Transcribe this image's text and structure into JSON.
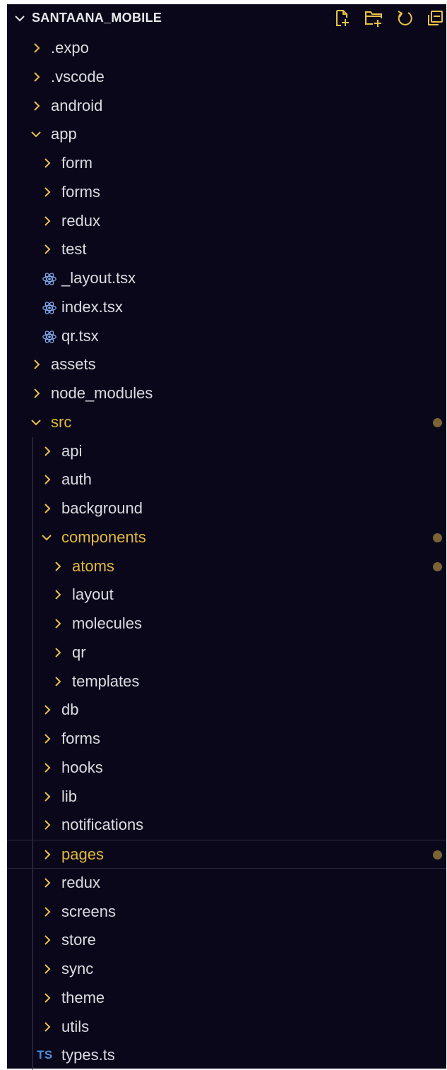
{
  "explorer": {
    "title": "SANTAANA_MOBILE",
    "actions": [
      "new-file-icon",
      "new-folder-icon",
      "refresh-icon",
      "collapse-all-icon"
    ]
  },
  "colors": {
    "background": "#090719",
    "modified_text": "#e2b93b",
    "arrow": "#e8c14a",
    "modified_dot": "#7a6435",
    "react_icon": "#7fa7e8",
    "ts_icon": "#4c8ed8"
  },
  "tree": [
    {
      "label": ".expo",
      "type": "folder",
      "depth": 0,
      "expanded": false
    },
    {
      "label": ".vscode",
      "type": "folder",
      "depth": 0,
      "expanded": false
    },
    {
      "label": "android",
      "type": "folder",
      "depth": 0,
      "expanded": false
    },
    {
      "label": "app",
      "type": "folder",
      "depth": 0,
      "expanded": true
    },
    {
      "label": "form",
      "type": "folder",
      "depth": 1,
      "expanded": false
    },
    {
      "label": "forms",
      "type": "folder",
      "depth": 1,
      "expanded": false
    },
    {
      "label": "redux",
      "type": "folder",
      "depth": 1,
      "expanded": false
    },
    {
      "label": "test",
      "type": "folder",
      "depth": 1,
      "expanded": false
    },
    {
      "label": "_layout.tsx",
      "type": "react",
      "depth": 1
    },
    {
      "label": "index.tsx",
      "type": "react",
      "depth": 1
    },
    {
      "label": "qr.tsx",
      "type": "react",
      "depth": 1
    },
    {
      "label": "assets",
      "type": "folder",
      "depth": 0,
      "expanded": false
    },
    {
      "label": "node_modules",
      "type": "folder",
      "depth": 0,
      "expanded": false
    },
    {
      "label": "src",
      "type": "folder",
      "depth": 0,
      "expanded": true,
      "modified": true,
      "dot": true
    },
    {
      "label": "api",
      "type": "folder",
      "depth": 1,
      "expanded": false
    },
    {
      "label": "auth",
      "type": "folder",
      "depth": 1,
      "expanded": false
    },
    {
      "label": "background",
      "type": "folder",
      "depth": 1,
      "expanded": false
    },
    {
      "label": "components",
      "type": "folder",
      "depth": 1,
      "expanded": true,
      "modified": true,
      "dot": true
    },
    {
      "label": "atoms",
      "type": "folder",
      "depth": 2,
      "expanded": false,
      "modified": true,
      "dot": true
    },
    {
      "label": "layout",
      "type": "folder",
      "depth": 2,
      "expanded": false
    },
    {
      "label": "molecules",
      "type": "folder",
      "depth": 2,
      "expanded": false
    },
    {
      "label": "qr",
      "type": "folder",
      "depth": 2,
      "expanded": false
    },
    {
      "label": "templates",
      "type": "folder",
      "depth": 2,
      "expanded": false
    },
    {
      "label": "db",
      "type": "folder",
      "depth": 1,
      "expanded": false
    },
    {
      "label": "forms",
      "type": "folder",
      "depth": 1,
      "expanded": false
    },
    {
      "label": "hooks",
      "type": "folder",
      "depth": 1,
      "expanded": false
    },
    {
      "label": "lib",
      "type": "folder",
      "depth": 1,
      "expanded": false
    },
    {
      "label": "notifications",
      "type": "folder",
      "depth": 1,
      "expanded": false
    },
    {
      "label": "pages",
      "type": "folder",
      "depth": 1,
      "expanded": false,
      "modified": true,
      "dot": true,
      "highlighted": true
    },
    {
      "label": "redux",
      "type": "folder",
      "depth": 1,
      "expanded": false
    },
    {
      "label": "screens",
      "type": "folder",
      "depth": 1,
      "expanded": false
    },
    {
      "label": "store",
      "type": "folder",
      "depth": 1,
      "expanded": false
    },
    {
      "label": "sync",
      "type": "folder",
      "depth": 1,
      "expanded": false
    },
    {
      "label": "theme",
      "type": "folder",
      "depth": 1,
      "expanded": false
    },
    {
      "label": "utils",
      "type": "folder",
      "depth": 1,
      "expanded": false
    },
    {
      "label": "types.ts",
      "type": "ts",
      "depth": 1,
      "icon_text": "TS"
    }
  ]
}
